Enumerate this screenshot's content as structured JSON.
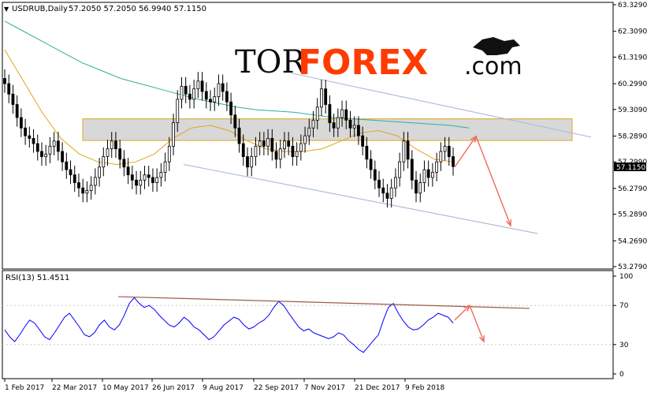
{
  "header": {
    "symbol": "USDRUB,Daily",
    "ohlc": "57.2050 57.2050 56.9940 57.1150",
    "rsi_label": "RSI(13) 51.4511"
  },
  "logo": {
    "part1": "TOR",
    "part2": "FOREX",
    "part3": ".com"
  },
  "current_price_label": "57.1150",
  "colors": {
    "candle": "#000000",
    "ma_slow": "#2fae9c",
    "ma_fast": "#e0a51c",
    "rsi_line": "#0000ff",
    "channel": "#aebfdb",
    "zone_fill": "#d8d8d8",
    "zone_border": "#e0a51c",
    "forecast_arrow": "#f06a5a",
    "rsi_trend": "#9c5a4a"
  },
  "chart_data": [
    {
      "type": "candlestick",
      "title": "USDRUB,Daily",
      "x_tick_labels": [
        "1 Feb 2017",
        "22 Mar 2017",
        "10 May 2017",
        "26 Jun 2017",
        "9 Aug 2017",
        "22 Sep 2017",
        "7 Nov 2017",
        "21 Dec 2017",
        "9 Feb 2018"
      ],
      "y_tick_labels": [
        "63.3290",
        "62.3090",
        "61.3190",
        "60.2990",
        "59.3090",
        "58.2890",
        "57.2990",
        "56.2790",
        "55.2890",
        "54.2690",
        "53.2790"
      ],
      "ylim": [
        53.279,
        63.329
      ],
      "last_price": 57.115,
      "series": [
        {
          "name": "Close",
          "values": [
            60.3,
            59.9,
            59.5,
            59.0,
            58.6,
            58.3,
            58.2,
            58.0,
            57.7,
            57.5,
            57.6,
            57.9,
            58.1,
            57.7,
            57.3,
            57.0,
            56.8,
            56.5,
            56.3,
            56.1,
            56.2,
            56.4,
            56.7,
            57.1,
            57.5,
            57.8,
            58.1,
            57.8,
            57.4,
            57.1,
            56.8,
            56.6,
            56.4,
            56.6,
            56.8,
            56.7,
            56.5,
            56.7,
            56.9,
            57.3,
            57.9,
            58.8,
            59.7,
            60.2,
            59.9,
            59.7,
            60.1,
            60.4,
            60.0,
            59.7,
            59.6,
            59.8,
            60.3,
            60.0,
            59.6,
            59.1,
            58.6,
            58.0,
            57.5,
            57.1,
            57.5,
            57.9,
            58.1,
            57.9,
            58.2,
            57.7,
            57.4,
            57.8,
            58.1,
            57.9,
            57.5,
            57.7,
            58.0,
            58.3,
            58.6,
            58.9,
            59.4,
            60.1,
            59.5,
            58.8,
            58.6,
            59.0,
            59.3,
            58.9,
            58.6,
            58.7,
            58.3,
            57.9,
            57.4,
            57.0,
            56.6,
            56.3,
            56.1,
            55.9,
            56.3,
            56.7,
            57.3,
            58.1,
            57.4,
            56.6,
            56.1,
            56.5,
            57.0,
            56.7,
            56.9,
            57.3,
            57.7,
            57.9,
            57.5,
            57.12
          ]
        },
        {
          "name": "MA slow",
          "values": [
            62.7,
            62.3,
            61.9,
            61.5,
            61.1,
            60.8,
            60.5,
            60.3,
            60.1,
            59.9,
            59.7,
            59.55,
            59.4,
            59.3,
            59.25,
            59.2,
            59.1,
            59.0,
            58.95,
            58.9,
            58.85,
            58.8,
            58.75,
            58.7,
            58.6
          ]
        },
        {
          "name": "MA fast",
          "values": [
            61.6,
            60.4,
            59.2,
            58.2,
            57.6,
            57.3,
            57.2,
            57.3,
            57.6,
            58.2,
            58.6,
            58.7,
            58.5,
            58.1,
            57.8,
            57.7,
            57.7,
            57.8,
            58.1,
            58.4,
            58.5,
            58.3,
            57.8,
            57.4,
            57.3
          ]
        }
      ]
    },
    {
      "type": "line",
      "title": "RSI(13) 51.4511",
      "y_tick_labels": [
        "100",
        "70",
        "30",
        "0"
      ],
      "ylim": [
        0,
        100
      ],
      "series": [
        {
          "name": "RSI(13)",
          "values": [
            45,
            38,
            33,
            40,
            48,
            55,
            52,
            45,
            38,
            35,
            42,
            50,
            58,
            62,
            55,
            48,
            40,
            38,
            42,
            50,
            55,
            48,
            45,
            50,
            60,
            72,
            78,
            72,
            68,
            70,
            66,
            60,
            55,
            50,
            48,
            52,
            58,
            54,
            48,
            45,
            40,
            35,
            38,
            44,
            50,
            54,
            58,
            56,
            50,
            46,
            48,
            52,
            55,
            60,
            68,
            74,
            70,
            62,
            55,
            48,
            44,
            46,
            42,
            40,
            38,
            36,
            38,
            42,
            40,
            34,
            30,
            25,
            22,
            28,
            34,
            40,
            55,
            68,
            72,
            62,
            54,
            48,
            45,
            46,
            50,
            55,
            58,
            62,
            60,
            58,
            52
          ]
        }
      ]
    }
  ]
}
